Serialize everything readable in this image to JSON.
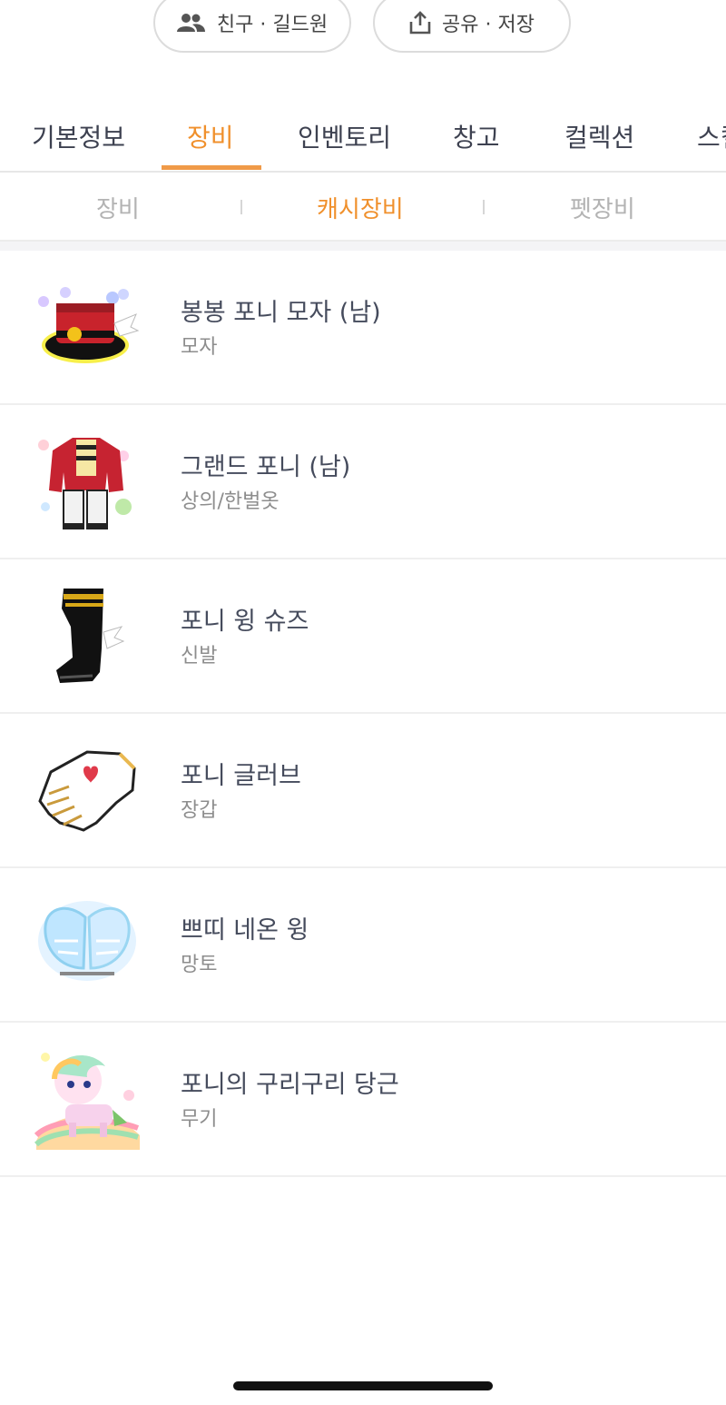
{
  "top_actions": {
    "friends": {
      "label": "친구 · 길드원",
      "icon": "people-icon"
    },
    "share": {
      "label": "공유 · 저장",
      "icon": "share-upload-icon"
    }
  },
  "tabs": [
    {
      "label": "기본정보",
      "active": false
    },
    {
      "label": "장비",
      "active": true
    },
    {
      "label": "인벤토리",
      "active": false
    },
    {
      "label": "창고",
      "active": false
    },
    {
      "label": "컬렉션",
      "active": false
    },
    {
      "label": "스킬",
      "active": false
    }
  ],
  "subtabs": [
    {
      "label": "장비",
      "active": false
    },
    {
      "label": "캐시장비",
      "active": true
    },
    {
      "label": "펫장비",
      "active": false
    }
  ],
  "items": [
    {
      "name": "봉봉 포니 모자 (남)",
      "type": "모자",
      "icon": "top-hat-icon"
    },
    {
      "name": "그랜드 포니 (남)",
      "type": "상의/한벌옷",
      "icon": "suit-outfit-icon"
    },
    {
      "name": "포니 윙 슈즈",
      "type": "신발",
      "icon": "winged-boot-icon"
    },
    {
      "name": "포니 글러브",
      "type": "장갑",
      "icon": "glove-icon"
    },
    {
      "name": "쁘띠 네온 윙",
      "type": "망토",
      "icon": "neon-wing-icon"
    },
    {
      "name": "포니의 구리구리 당근",
      "type": "무기",
      "icon": "pony-weapon-icon"
    }
  ],
  "colors": {
    "accent": "#f0902c",
    "text": "#3c4150",
    "muted": "#8d8d8d"
  }
}
